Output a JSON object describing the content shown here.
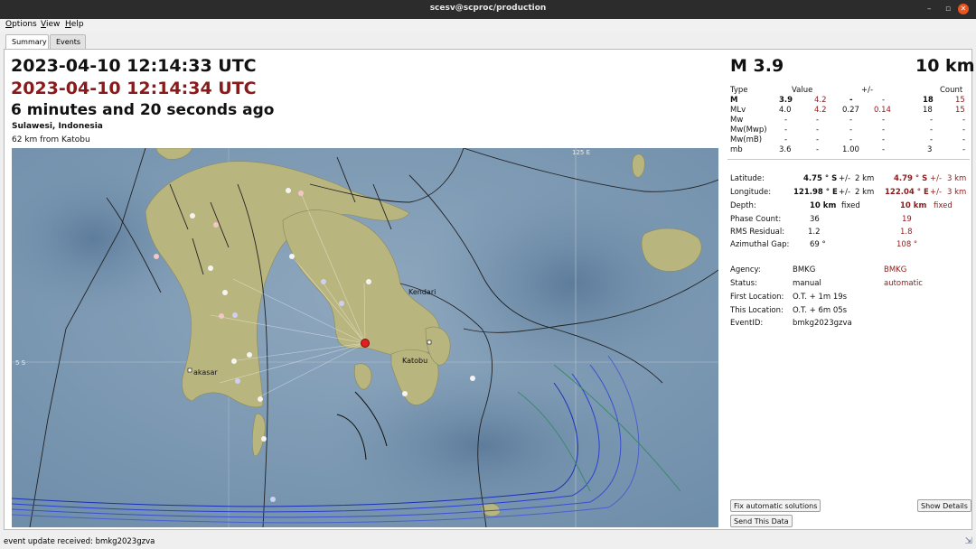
{
  "window": {
    "title": "scesv@scproc/production",
    "minimize": "–",
    "maximize": "▫",
    "close": "✕"
  },
  "menu": [
    "Options",
    "View",
    "Help"
  ],
  "tabs": [
    "Summary",
    "Events"
  ],
  "origin_time": "2023-04-10 12:14:33 UTC",
  "auto_time": "2023-04-10 12:14:34 UTC",
  "ago": "6 minutes and 20 seconds ago",
  "region": "Sulawesi, Indonesia",
  "nearest_city": "62 km from Katobu",
  "map_labels": {
    "lat": "5 S",
    "lon": "125 E",
    "city1": "Kendari",
    "city2": "Katobu",
    "city3": "akasar"
  },
  "magnitude_header": "M 3.9",
  "depth_header": "10 km",
  "mag_table": {
    "headers": {
      "type": "Type",
      "value": "Value",
      "pm": "+/-",
      "count": "Count"
    },
    "rows": [
      {
        "type": "M",
        "v1": "3.9",
        "v2": "4.2",
        "e1": "-",
        "e2": "-",
        "c1": "18",
        "c2": "15"
      },
      {
        "type": "MLv",
        "v1": "4.0",
        "v2": "4.2",
        "e1": "0.27",
        "e2": "0.14",
        "c1": "18",
        "c2": "15"
      },
      {
        "type": "Mw",
        "v1": "-",
        "v2": "-",
        "e1": "-",
        "e2": "-",
        "c1": "-",
        "c2": "-"
      },
      {
        "type": "Mw(Mwp)",
        "v1": "-",
        "v2": "-",
        "e1": "-",
        "e2": "-",
        "c1": "-",
        "c2": "-"
      },
      {
        "type": "Mw(mB)",
        "v1": "-",
        "v2": "-",
        "e1": "-",
        "e2": "-",
        "c1": "-",
        "c2": "-"
      },
      {
        "type": "mb",
        "v1": "3.6",
        "v2": "-",
        "e1": "1.00",
        "e2": "-",
        "c1": "3",
        "c2": "-"
      }
    ]
  },
  "location": {
    "labels": {
      "lat": "Latitude:",
      "lon": "Longitude:",
      "depth": "Depth:",
      "phase": "Phase Count:",
      "rms": "RMS Residual:",
      "gap": "Azimuthal Gap:"
    },
    "pm": "+/-",
    "lat": {
      "v1": "4.75 ° S",
      "e1": "2 km",
      "v2": "4.79 ° S",
      "e2": "3 km"
    },
    "lon": {
      "v1": "121.98 ° E",
      "e1": "2 km",
      "v2": "122.04 ° E",
      "e2": "3 km"
    },
    "depth": {
      "v1": "10 km",
      "f1": "fixed",
      "v2": "10 km",
      "f2": "fixed"
    },
    "phase": {
      "v1": "36",
      "v2": "19"
    },
    "rms": {
      "v1": "1.2",
      "v2": "1.8"
    },
    "gap": {
      "v1": "69 °",
      "v2": "108 °"
    }
  },
  "info": {
    "labels": {
      "agency": "Agency:",
      "status": "Status:",
      "first": "First Location:",
      "this": "This Location:",
      "eventid": "EventID:"
    },
    "agency": {
      "v1": "BMKG",
      "v2": "BMKG"
    },
    "status": {
      "v1": "manual",
      "v2": "automatic"
    },
    "first": "O.T. + 1m 19s",
    "this": "O.T. + 6m 05s",
    "eventid": "bmkg2023gzva"
  },
  "buttons": {
    "fix": "Fix automatic solutions",
    "details": "Show Details",
    "send": "Send This Data"
  },
  "status_text": "event update received: bmkg2023gzva",
  "colors": {
    "auto_red": "#8a1a1a",
    "epicenter": "#e02020",
    "titlebar": "#2c2c2c"
  }
}
